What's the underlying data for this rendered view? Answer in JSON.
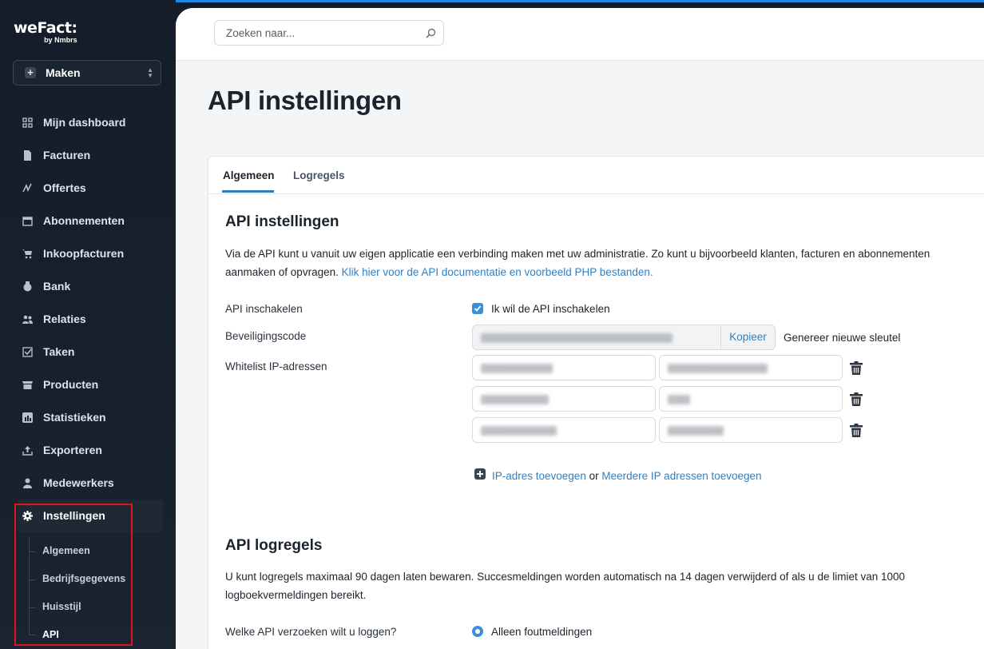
{
  "brand": {
    "name": "weFact:",
    "sub": "by Nmbrs"
  },
  "maker": {
    "label": "Maken"
  },
  "nav": {
    "items": [
      {
        "label": "Mijn dashboard",
        "icon": "dashboard-icon"
      },
      {
        "label": "Facturen",
        "icon": "invoice-icon"
      },
      {
        "label": "Offertes",
        "icon": "quote-icon"
      },
      {
        "label": "Abonnementen",
        "icon": "calendar-icon"
      },
      {
        "label": "Inkoopfacturen",
        "icon": "cart-icon"
      },
      {
        "label": "Bank",
        "icon": "bank-icon"
      },
      {
        "label": "Relaties",
        "icon": "people-icon"
      },
      {
        "label": "Taken",
        "icon": "checkbox-icon"
      },
      {
        "label": "Producten",
        "icon": "box-icon"
      },
      {
        "label": "Statistieken",
        "icon": "chart-icon"
      },
      {
        "label": "Exporteren",
        "icon": "export-icon"
      },
      {
        "label": "Medewerkers",
        "icon": "employee-icon"
      },
      {
        "label": "Instellingen",
        "icon": "gear-icon"
      }
    ],
    "sub_items": [
      "Algemeen",
      "Bedrijfsgegevens",
      "Huisstijl",
      "API"
    ],
    "active_sub": "API"
  },
  "search": {
    "placeholder": "Zoeken naar..."
  },
  "page": {
    "title": "API instellingen"
  },
  "tabs": [
    "Algemeen",
    "Logregels"
  ],
  "settings": {
    "title": "API instellingen",
    "intro": "Via de API kunt u vanuit uw eigen applicatie een verbinding maken met uw administratie. Zo kunt u bijvoorbeeld klanten, facturen en abonnementen aanmaken of opvragen. ",
    "intro_link": "Klik hier voor de API documentatie en voorbeeld PHP bestanden.",
    "enable_label": "API inschakelen",
    "enable_checkbox_label": "Ik wil de API inschakelen",
    "security_label": "Beveiligingscode",
    "copy_button": "Kopieer",
    "regenerate_link": "Genereer nieuwe sleutel",
    "whitelist_label": "Whitelist IP-adressen",
    "add_ip_link": "IP-adres toevoegen",
    "or_text": "or",
    "add_multiple_link": "Meerdere IP adressen toevoegen"
  },
  "log": {
    "title": "API logregels",
    "text": "U kunt logregels maximaal 90 dagen laten bewaren. Succesmeldingen worden automatisch na 14 dagen verwijderd of als u de limiet van 1000 logboekvermeldingen bereikt.",
    "question_label": "Welke API verzoeken wilt u loggen?",
    "option_selected": "Alleen foutmeldingen"
  }
}
